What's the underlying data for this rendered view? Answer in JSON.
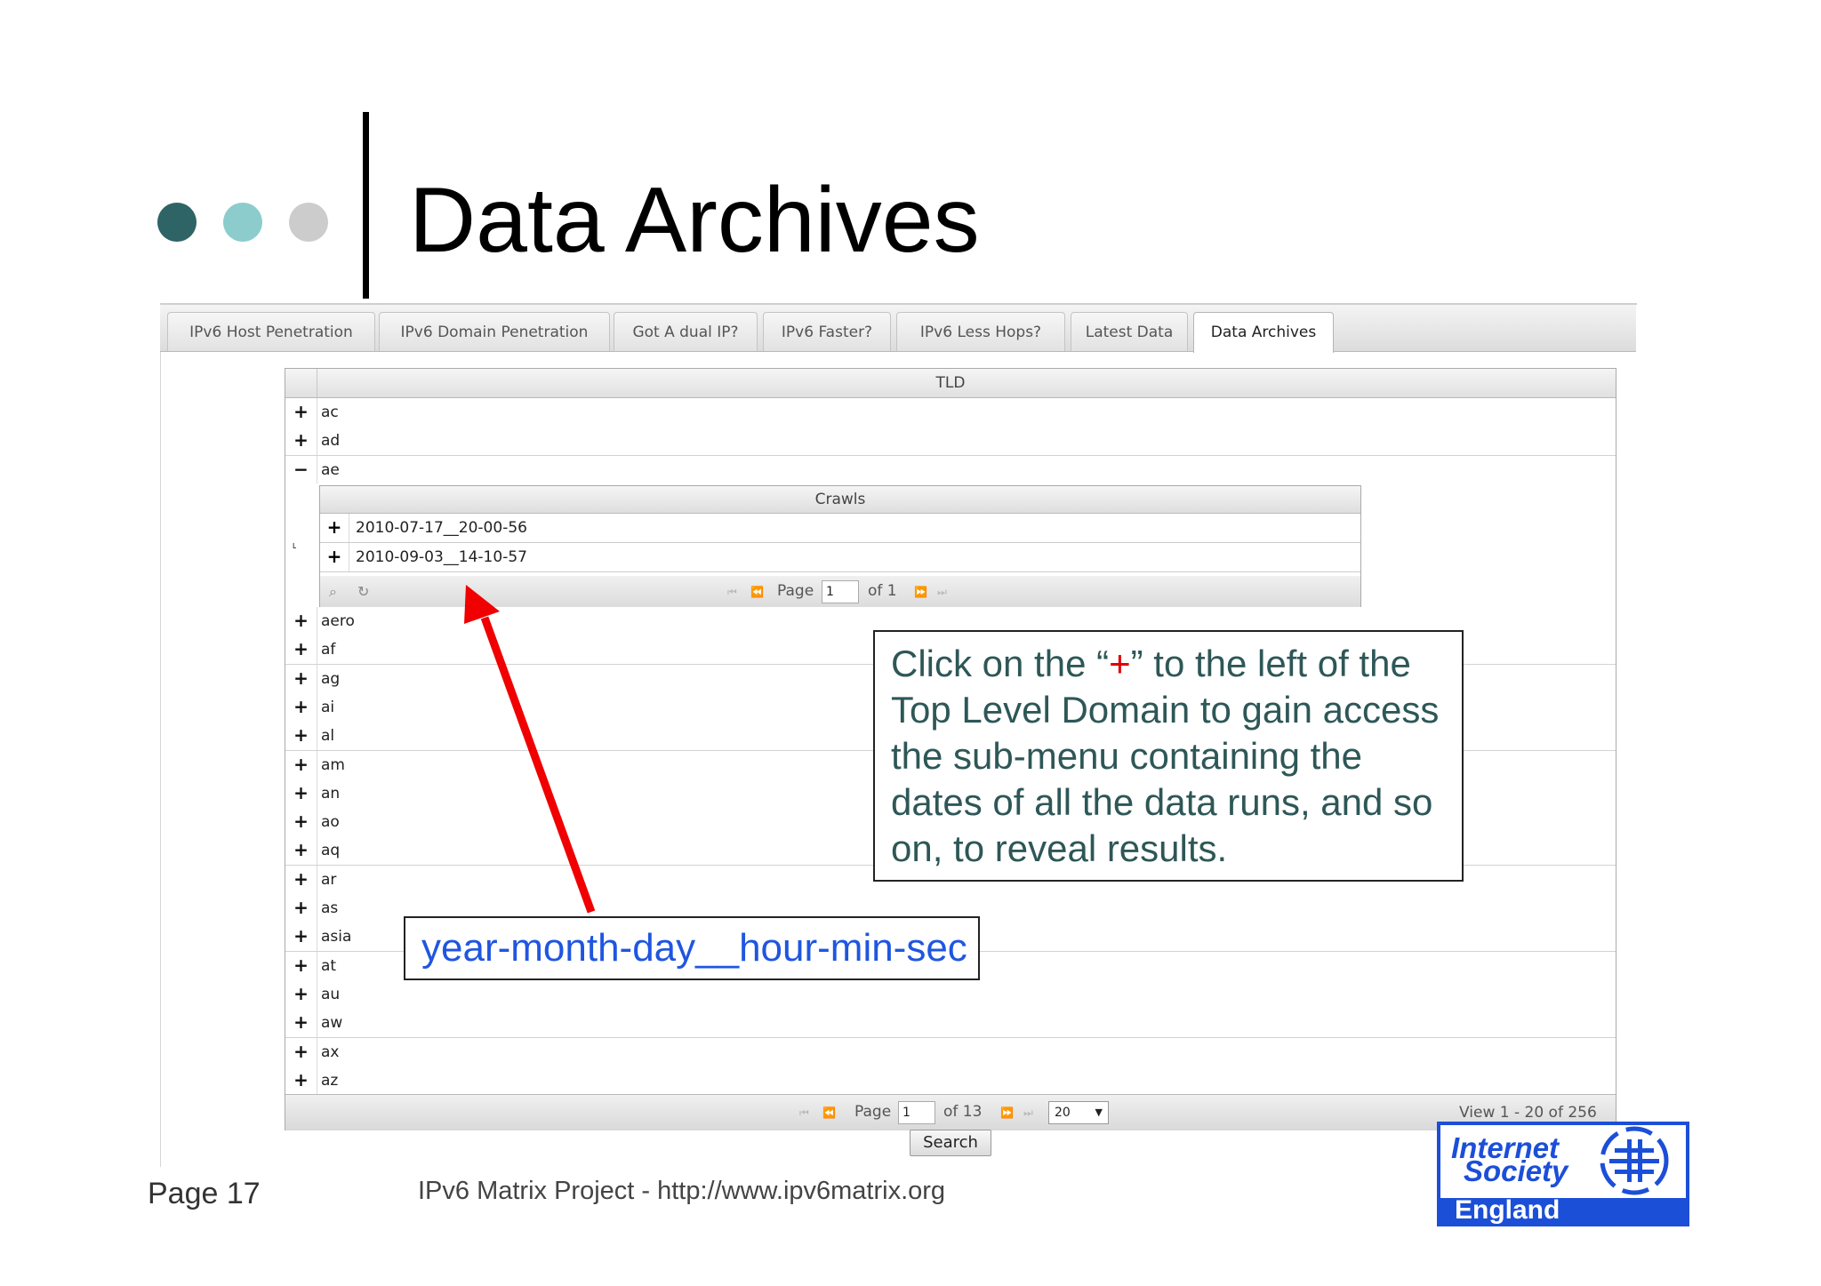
{
  "slide": {
    "title": "Data Archives",
    "dot_colors": [
      "#2f6466",
      "#8ccccc",
      "#cccccc"
    ],
    "page_label": "Page 17",
    "footer_text": "IPv6 Matrix Project - http://www.ipv6matrix.org"
  },
  "tabs": [
    {
      "label": "IPv6 Host Penetration",
      "active": false
    },
    {
      "label": "IPv6 Domain Penetration",
      "active": false
    },
    {
      "label": "Got A dual IP?",
      "active": false
    },
    {
      "label": "IPv6 Faster?",
      "active": false
    },
    {
      "label": "IPv6 Less Hops?",
      "active": false
    },
    {
      "label": "Latest Data",
      "active": false
    },
    {
      "label": "Data Archives",
      "active": true
    }
  ],
  "grid": {
    "column_header": "TLD",
    "rows_before_expanded": [
      {
        "expander": "+",
        "tld": "ac"
      },
      {
        "expander": "+",
        "tld": "ad"
      },
      {
        "expander": "−",
        "tld": "ae"
      }
    ],
    "subgrid": {
      "corner_glyph": "˪",
      "column_header": "Crawls",
      "rows": [
        {
          "expander": "+",
          "crawl": "2010-07-17__20-00-56"
        },
        {
          "expander": "+",
          "crawl": "2010-09-03__14-10-57"
        }
      ],
      "pager": {
        "page_label": "Page",
        "page_value": "1",
        "of_label": "of 1"
      }
    },
    "rows_after_expanded": [
      {
        "expander": "+",
        "tld": "aero"
      },
      {
        "expander": "+",
        "tld": "af"
      },
      {
        "expander": "+",
        "tld": "ag"
      },
      {
        "expander": "+",
        "tld": "ai"
      },
      {
        "expander": "+",
        "tld": "al"
      },
      {
        "expander": "+",
        "tld": "am"
      },
      {
        "expander": "+",
        "tld": "an"
      },
      {
        "expander": "+",
        "tld": "ao"
      },
      {
        "expander": "+",
        "tld": "aq"
      },
      {
        "expander": "+",
        "tld": "ar"
      },
      {
        "expander": "+",
        "tld": "as"
      },
      {
        "expander": "+",
        "tld": "asia"
      },
      {
        "expander": "+",
        "tld": "at"
      },
      {
        "expander": "+",
        "tld": "au"
      },
      {
        "expander": "+",
        "tld": "aw"
      },
      {
        "expander": "+",
        "tld": "ax"
      },
      {
        "expander": "+",
        "tld": "az"
      }
    ],
    "pager": {
      "page_label": "Page",
      "page_value": "1",
      "of_label": "of 13",
      "rows_per_page": "20",
      "view_text": "View 1 - 20 of 256"
    },
    "search_button": "Search"
  },
  "callouts": {
    "instruction_before": "Click on the “",
    "instruction_plus": "+",
    "instruction_after": "” to the left of the Top Level Domain to gain access the sub-menu containing the dates of all the data runs, and so on, to reveal results.",
    "format_hint": "year-month-day__hour-min-sec",
    "arrow_color": "#f00000",
    "plus_color": "#e00000"
  },
  "logo": {
    "line1": "Internet",
    "line2": "Society",
    "line3": "England",
    "color": "#1c4fd8"
  }
}
